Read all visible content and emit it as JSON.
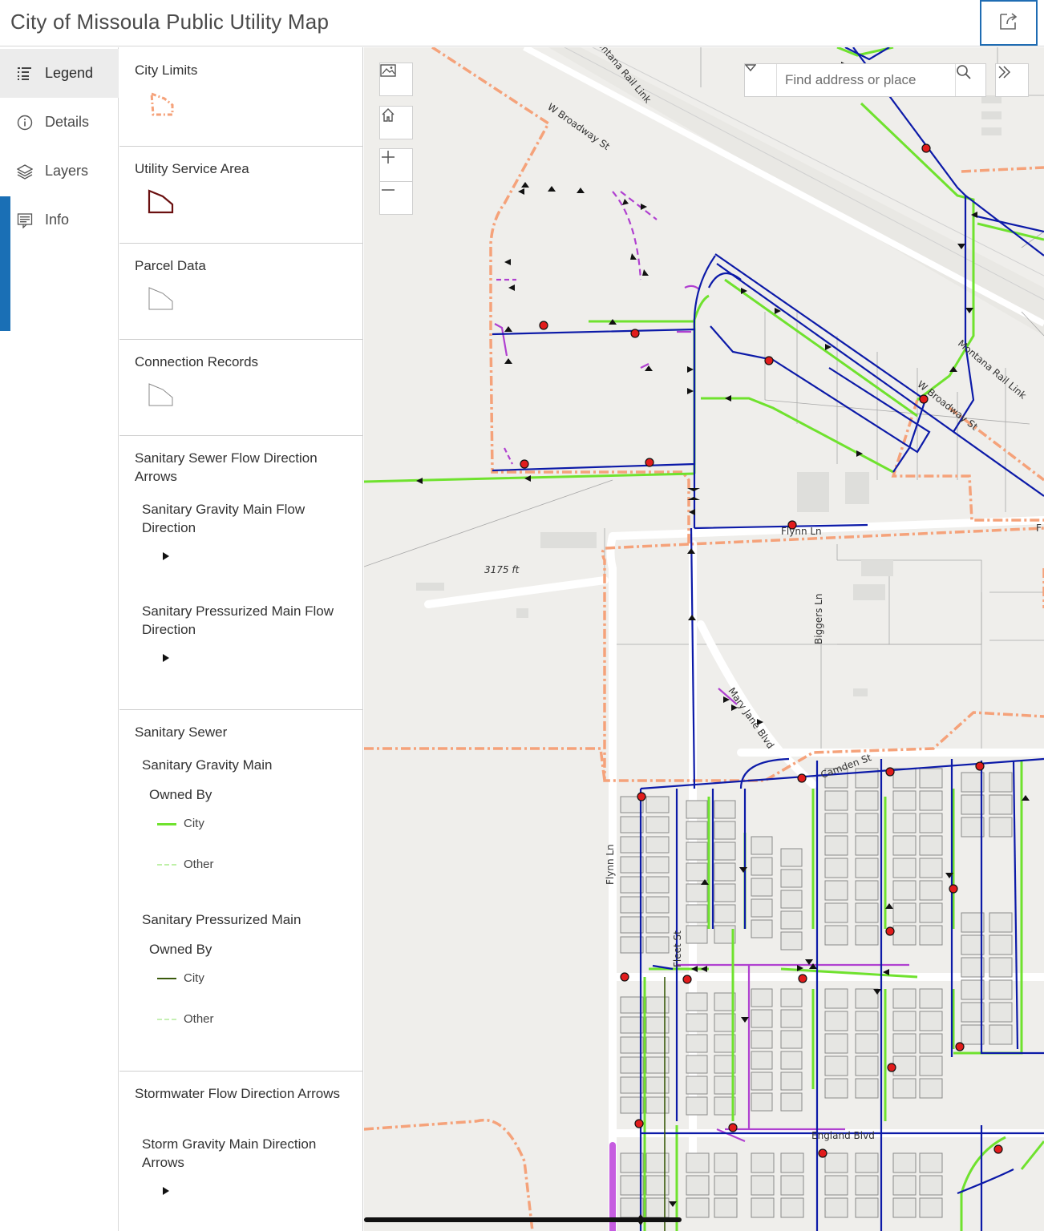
{
  "header": {
    "title": "City of Missoula Public Utility Map",
    "share_icon": "share-icon"
  },
  "nav": {
    "items": [
      {
        "label": "Legend",
        "icon": "legend-icon",
        "active": true
      },
      {
        "label": "Details",
        "icon": "info-circle-icon",
        "active": false
      },
      {
        "label": "Layers",
        "icon": "layers-icon",
        "active": false
      },
      {
        "label": "Info",
        "icon": "info-panel-icon",
        "active": false
      }
    ]
  },
  "legend": {
    "city_limits": "City Limits",
    "utility_service_area": "Utility Service Area",
    "parcel_data": "Parcel Data",
    "connection_records": "Connection Records",
    "sewer_flow_title": "Sanitary Sewer Flow Direction Arrows",
    "gravity_flow_dir": "Sanitary Gravity Main Flow Direction",
    "pressurized_flow_dir": "Sanitary Pressurized Main Flow Direction",
    "sanitary_sewer": "Sanitary Sewer",
    "gravity_main": "Sanitary Gravity Main",
    "owned_by_1": "Owned By",
    "city_1": "City",
    "other_1": "Other",
    "pressurized_main": "Sanitary Pressurized Main",
    "owned_by_2": "Owned By",
    "city_2": "City",
    "other_2": "Other",
    "storm_flow_title": "Stormwater Flow Direction Arrows",
    "storm_gravity_dir": "Storm Gravity Main Direction Arrows"
  },
  "map": {
    "search_placeholder": "Find address or place",
    "labels": {
      "montana_rail_top": "Montana Rail Link",
      "w_broadway_top": "W Broadway St",
      "montana_rail_right": "Montana Rail Link",
      "w_broadway_right": "W Broadway St",
      "flynn_ln_h": "Flynn Ln",
      "flynn_ln_edge": "F",
      "elevation": "3175 ft",
      "biggers_ln": "Biggers Ln",
      "mary_jane_blvd": "Mary Jane Blvd",
      "camden_st": "Camden St",
      "flynn_ln_v": "Flynn Ln",
      "fleet_st": "Fleet St",
      "england_blvd": "England Blvd"
    }
  },
  "colors": {
    "city_gravity": "#6fe22e",
    "other_gravity": "#bff0a8",
    "city_pressurized": "#3a5a0c",
    "other_pressurized": "#c6f0b4",
    "water_main": "#0c1aa8",
    "city_limits": "#f5a27a",
    "storm": "#b040d0",
    "manhole": "#e11c1c",
    "service_area": "#6a0f0f"
  }
}
